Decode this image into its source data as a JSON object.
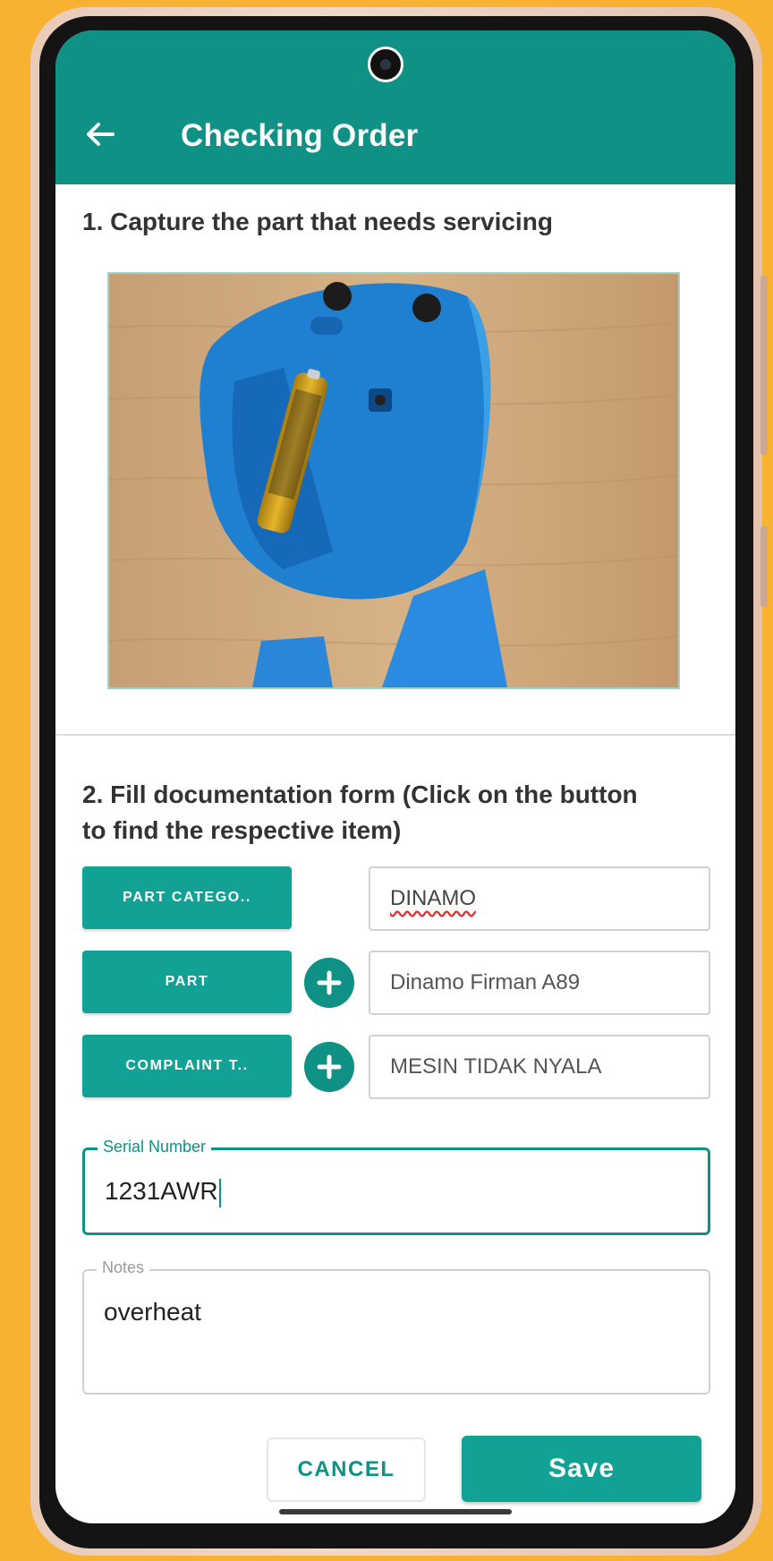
{
  "header": {
    "back_icon": "arrow-left-icon",
    "title": "Checking Order"
  },
  "step1": {
    "label": "1. Capture the part that needs servicing",
    "photo_alt": "captured-part-photo"
  },
  "step2": {
    "label_line1": "2. Fill documentation form (Click on the button",
    "label_line2": "to find the respective item)"
  },
  "form": {
    "part_category": {
      "button_label": "PART CATEGO..",
      "value": "DINAMO"
    },
    "part": {
      "button_label": "PART",
      "value": "Dinamo Firman A89"
    },
    "complaint": {
      "button_label": "COMPLAINT T..",
      "value": "MESIN TIDAK NYALA"
    },
    "serial_number": {
      "label": "Serial Number",
      "value": "1231AWR"
    },
    "notes": {
      "label": "Notes",
      "value": "overheat"
    }
  },
  "actions": {
    "cancel_label": "CANCEL",
    "save_label": "Save"
  },
  "colors": {
    "primary": "#0f9186",
    "button": "#12a295",
    "background": "#f7b232"
  }
}
